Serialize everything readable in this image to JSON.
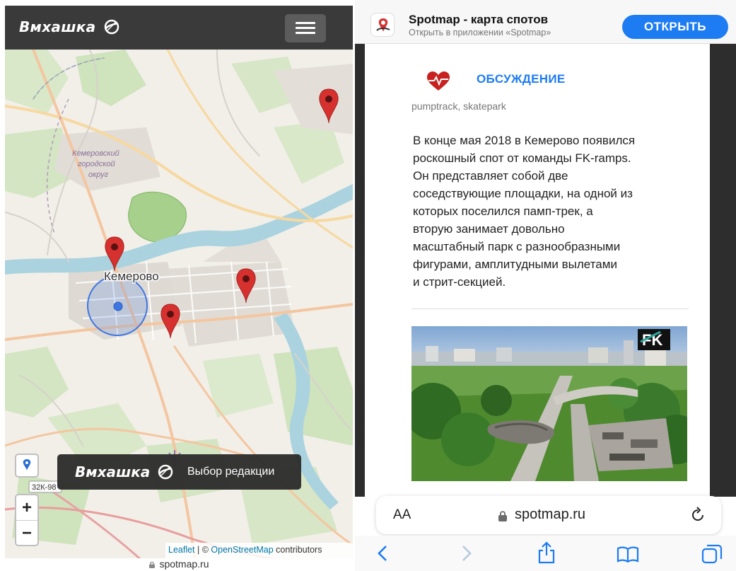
{
  "left_pane": {
    "logo_text": "Вмхашка",
    "map": {
      "city_label": "Кемерово",
      "district_label_1": "Кемеровский",
      "district_label_2": "городской",
      "district_label_3": "округ",
      "road_badge": "32К-98"
    },
    "banner": {
      "logo_text": "Вмхашка",
      "label": "Выбор редакции"
    },
    "zoom_in_label": "+",
    "zoom_out_label": "−",
    "attribution": {
      "leaflet": "Leaflet",
      "separator": " | © ",
      "osm": "OpenStreetMap",
      "contributors": " contributors"
    },
    "bottom_url": "spotmap.ru"
  },
  "right_pane": {
    "app_banner": {
      "title": "Spotmap - карта спотов",
      "subtitle": "Открыть в приложении «Spotmap»",
      "open_button": "ОТКРЫТЬ"
    },
    "section_title": "ОБСУЖДЕНИЕ",
    "tags": "pumptrack, skatepark",
    "description": "В конце мая 2018 в Кемерово появился\nроскошный спот от команды FK-ramps.\nОн представляет собой две\nсоседствующие площадки, на одной из\nкоторых поселился памп-трек, а\nвторую занимает довольно\nмасштабный парк с разнообразными\nфигурами, амплитудными вылетами\nи стрит-секцией.",
    "url_bar": {
      "aa_label": "AA",
      "url": "spotmap.ru"
    }
  },
  "colors": {
    "header_dark": "#3a3a3a",
    "open_button": "#1d7cf2",
    "section_title": "#1d7cf2",
    "marker_red": "#d7312f",
    "river": "#aad3df",
    "park_green": "#a8d08d"
  }
}
